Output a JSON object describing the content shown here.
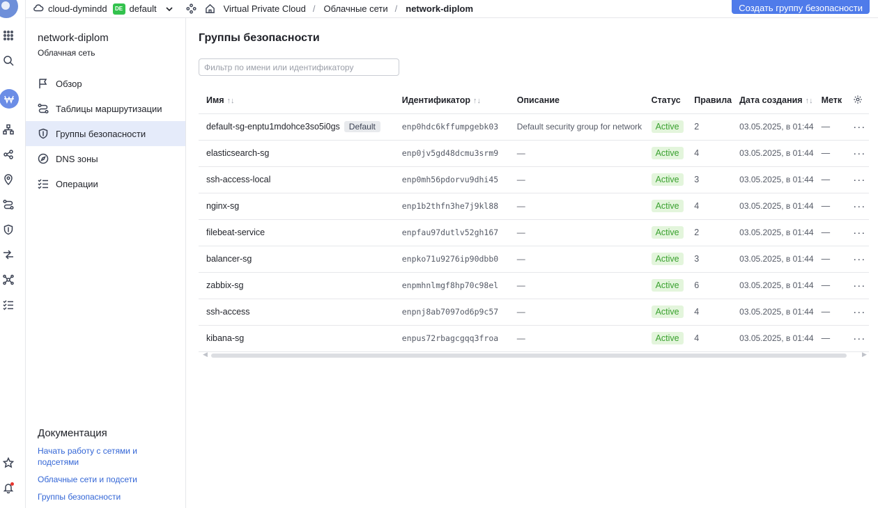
{
  "topbar": {
    "cloud_name": "cloud-dymindd",
    "folder_badge": "DE",
    "folder_name": "default",
    "breadcrumbs": [
      "Virtual Private Cloud",
      "Облачные сети",
      "network-diplom"
    ],
    "separator": "/",
    "create_button": "Создать группу безопасности"
  },
  "sidebar": {
    "title": "network-diplom",
    "subtitle": "Облачная сеть",
    "items": [
      {
        "label": "Обзор",
        "icon": "flag-icon"
      },
      {
        "label": "Таблицы маршрутизации",
        "icon": "route-icon"
      },
      {
        "label": "Группы безопасности",
        "icon": "shield-icon",
        "active": true
      },
      {
        "label": "DNS зоны",
        "icon": "compass-icon"
      },
      {
        "label": "Операции",
        "icon": "list-check-icon"
      }
    ],
    "docs_title": "Документация",
    "docs_links": [
      "Начать работу с сетями и подсетями",
      "Облачные сети и подсети",
      "Группы безопасности"
    ]
  },
  "main": {
    "title": "Группы безопасности",
    "filter_placeholder": "Фильтр по имени или идентификатору",
    "columns": {
      "name": "Имя",
      "id": "Идентификатор",
      "description": "Описание",
      "status": "Статус",
      "rules": "Правила",
      "created": "Дата создания",
      "labels": "Метк"
    },
    "sort_glyph": "↑↓",
    "more_glyph": "···",
    "default_badge": "Default",
    "rows": [
      {
        "name": "default-sg-enptu1mdohce3so5i0gs",
        "default": true,
        "id": "enp0hdc6kffumpgebk03",
        "description": "Default security group for network",
        "status": "Active",
        "rules": "2",
        "created": "03.05.2025, в 01:44",
        "labels": "—"
      },
      {
        "name": "elasticsearch-sg",
        "id": "enp0jv5gd48dcmu3srm9",
        "description": "—",
        "status": "Active",
        "rules": "4",
        "created": "03.05.2025, в 01:44",
        "labels": "—"
      },
      {
        "name": "ssh-access-local",
        "id": "enp0mh56pdorvu9dhi45",
        "description": "—",
        "status": "Active",
        "rules": "3",
        "created": "03.05.2025, в 01:44",
        "labels": "—"
      },
      {
        "name": "nginx-sg",
        "id": "enp1b2thfn3he7j9kl88",
        "description": "—",
        "status": "Active",
        "rules": "4",
        "created": "03.05.2025, в 01:44",
        "labels": "—"
      },
      {
        "name": "filebeat-service",
        "id": "enpfau97dutlv52gh167",
        "description": "—",
        "status": "Active",
        "rules": "2",
        "created": "03.05.2025, в 01:44",
        "labels": "—"
      },
      {
        "name": "balancer-sg",
        "id": "enpko71u9276ip90dbb0",
        "description": "—",
        "status": "Active",
        "rules": "3",
        "created": "03.05.2025, в 01:44",
        "labels": "—"
      },
      {
        "name": "zabbix-sg",
        "id": "enpmhnlmgf8hp70c98el",
        "description": "—",
        "status": "Active",
        "rules": "6",
        "created": "03.05.2025, в 01:44",
        "labels": "—"
      },
      {
        "name": "ssh-access",
        "id": "enpnj8ab7097od6p9c57",
        "description": "—",
        "status": "Active",
        "rules": "4",
        "created": "03.05.2025, в 01:44",
        "labels": "—"
      },
      {
        "name": "kibana-sg",
        "id": "enpus72rbagcgqq3froa",
        "description": "—",
        "status": "Active",
        "rules": "4",
        "created": "03.05.2025, в 01:44",
        "labels": "—"
      }
    ]
  },
  "colors": {
    "accent": "#4f7bea",
    "active_nav": "#e5ebfa",
    "status_bg": "#e3f5dc",
    "status_text": "#3aa12f",
    "link": "#3366d6"
  }
}
